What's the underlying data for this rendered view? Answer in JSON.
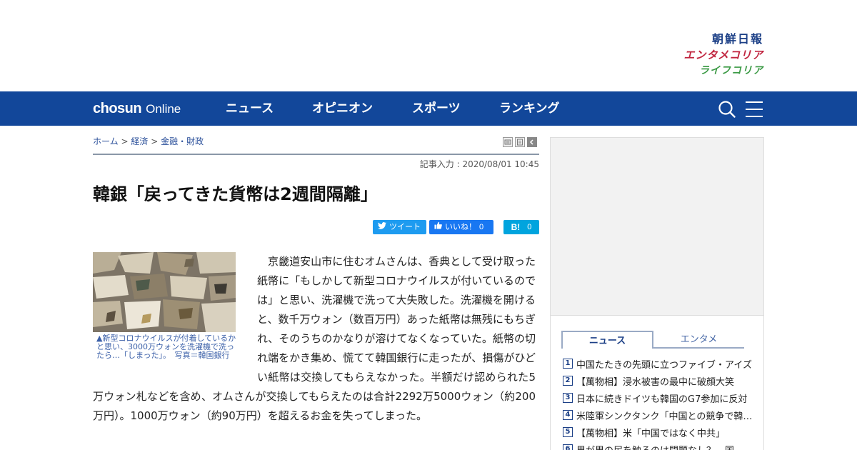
{
  "logos": {
    "chosun_ilbo": "朝鮮日報",
    "entame_korea": "エンタメコリア",
    "life_korea": "ライフコリア"
  },
  "nav": {
    "brand_main": "chosun",
    "brand_sub": "Online",
    "items": [
      "ニュース",
      "オピニオン",
      "スポーツ",
      "ランキング"
    ],
    "search_icon": "search-icon",
    "menu_icon": "hamburger-menu-icon",
    "bar_color": "#12479a"
  },
  "breadcrumb": {
    "home": "ホーム",
    "sep": ">",
    "section": "経済",
    "subsection": "金融・財政"
  },
  "article": {
    "date_label": "記事入力 : 2020/08/01 10:45",
    "headline": "韓銀「戻ってきた貨幣は2週間隔離」",
    "social": {
      "tweet": "ツイート",
      "like": "いいね！",
      "like_count": "0",
      "hatena": "B!",
      "hatena_count": "0"
    },
    "photo_caption": "▲新型コロナウイルスが付着しているかと思い、3000万ウォンを洗濯機で洗ったら…「しまった」。　写真＝韓国銀行",
    "body": "　京畿道安山市に住むオムさんは、香典として受け取った紙幣に「もしかして新型コロナウイルスが付いているのでは」と思い、洗濯機で洗って大失敗した。洗濯機を開けると、数千万ウォン（数百万円）あった紙幣は無残にもちぎれ、そのうちのかなりが溶けてなくなっていた。紙幣の切れ端をかき集め、慌てて韓国銀行に走ったが、損傷がひどい紙幣は交換してもらえなかった。半額だけ認められた5万ウォン札などを含め、オムさんが交換してもらえたのは合計2292万5000ウォン（約200万円）。1000万ウォン（約90万円）を超えるお金を失ってしまった。"
  },
  "sidebar": {
    "tabs": [
      "ニュース",
      "エンタメ"
    ],
    "ranking": [
      {
        "rank": "1",
        "title": "中国たたきの先頭に立つファイブ・アイズ"
      },
      {
        "rank": "2",
        "title": "【萬物相】浸水被害の最中に破顔大笑"
      },
      {
        "rank": "3",
        "title": "日本に続きドイツも韓国のG7参加に反対"
      },
      {
        "rank": "4",
        "title": "米陸軍シンクタンク「中国との競争で韓国は"
      },
      {
        "rank": "5",
        "title": "【萬物相】米「中国ではなく中共」"
      },
      {
        "rank": "6",
        "title": "男が男の尻を触るのは問題なし？…国"
      }
    ]
  }
}
